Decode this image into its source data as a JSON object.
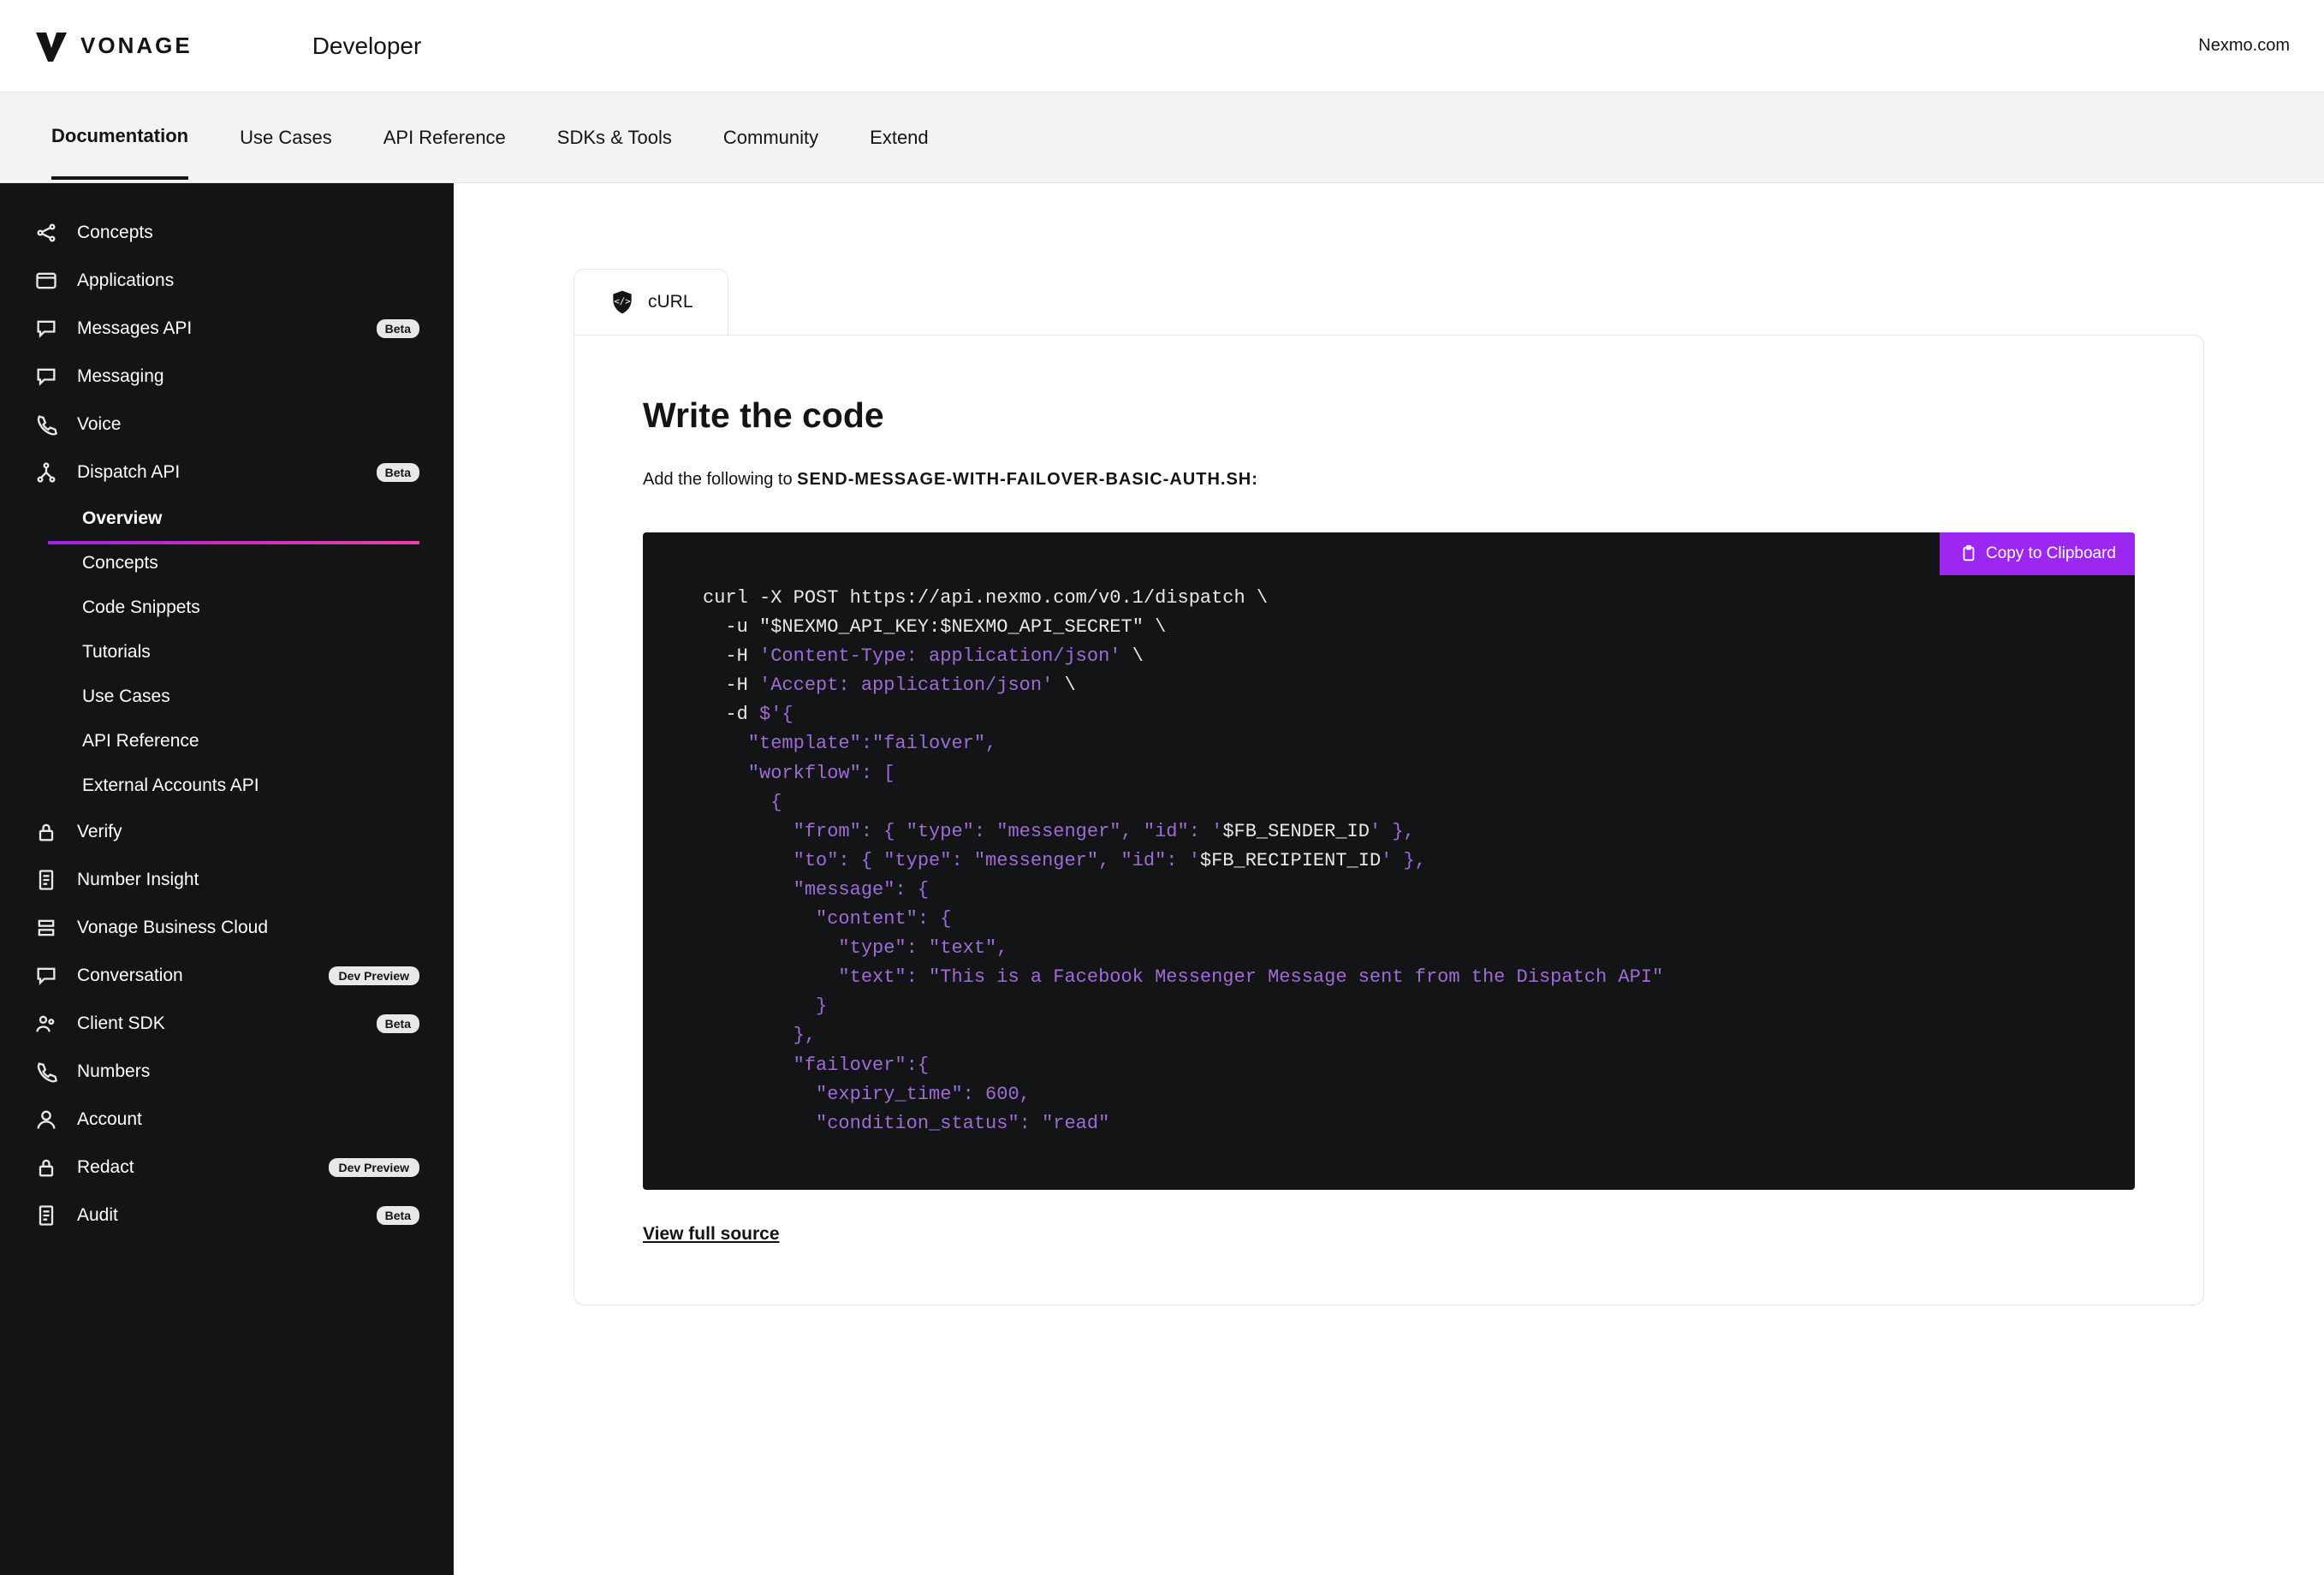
{
  "header": {
    "brand": "VONAGE",
    "developer": "Developer",
    "external_link": "Nexmo.com"
  },
  "topnav": [
    {
      "label": "Documentation",
      "active": true
    },
    {
      "label": "Use Cases"
    },
    {
      "label": "API Reference"
    },
    {
      "label": "SDKs & Tools"
    },
    {
      "label": "Community"
    },
    {
      "label": "Extend"
    }
  ],
  "sidebar": {
    "top": [
      {
        "icon": "share",
        "label": "Concepts"
      },
      {
        "icon": "window",
        "label": "Applications"
      },
      {
        "icon": "chat",
        "label": "Messages API",
        "badge": "Beta"
      },
      {
        "icon": "chat",
        "label": "Messaging"
      },
      {
        "icon": "phone",
        "label": "Voice"
      },
      {
        "icon": "tree",
        "label": "Dispatch API",
        "badge": "Beta"
      }
    ],
    "sub": [
      {
        "label": "Overview",
        "active": true
      },
      {
        "label": "Concepts"
      },
      {
        "label": "Code Snippets"
      },
      {
        "label": "Tutorials"
      },
      {
        "label": "Use Cases"
      },
      {
        "label": "API Reference"
      },
      {
        "label": "External Accounts API"
      }
    ],
    "bottom": [
      {
        "icon": "lock",
        "label": "Verify"
      },
      {
        "icon": "doc",
        "label": "Number Insight"
      },
      {
        "icon": "stack",
        "label": "Vonage Business Cloud"
      },
      {
        "icon": "chat",
        "label": "Conversation",
        "badge": "Dev Preview"
      },
      {
        "icon": "users",
        "label": "Client SDK",
        "badge": "Beta"
      },
      {
        "icon": "dial",
        "label": "Numbers"
      },
      {
        "icon": "user",
        "label": "Account"
      },
      {
        "icon": "lock",
        "label": "Redact",
        "badge": "Dev Preview"
      },
      {
        "icon": "doc",
        "label": "Audit",
        "badge": "Beta"
      }
    ]
  },
  "content": {
    "tab_label": "cURL",
    "heading": "Write the code",
    "instruction_prefix": "Add the following to ",
    "filename": "SEND-MESSAGE-WITH-FAILOVER-BASIC-AUTH.SH:",
    "copy_label": "Copy to Clipboard",
    "view_source": "View full source",
    "code": {
      "l1": "curl -X POST https://api.nexmo.com/v0.1/dispatch \\",
      "l2a": "  -u \"",
      "l2b": "$NEXMO_API_KEY",
      "l2c": ":",
      "l2d": "$NEXMO_API_SECRET",
      "l2e": "\" \\",
      "l3a": "  -H ",
      "l3b": "'Content-Type: application/json'",
      "l3c": " \\",
      "l4a": "  -H ",
      "l4b": "'Accept: application/json'",
      "l4c": " \\",
      "l5a": "  -d ",
      "l5b": "$'",
      "l5c": "{",
      "l6": "    \"template\":\"failover\",",
      "l7": "    \"workflow\": [",
      "l8": "      {",
      "l9a": "        \"from\": { \"type\": \"messenger\", \"id\": '",
      "l9b": "$FB_SENDER_ID",
      "l9c": "' },",
      "l10a": "        \"to\": { \"type\": \"messenger\", \"id\": '",
      "l10b": "$FB_RECIPIENT_ID",
      "l10c": "' },",
      "l11": "        \"message\": {",
      "l12": "          \"content\": {",
      "l13": "            \"type\": \"text\",",
      "l14": "            \"text\": \"This is a Facebook Messenger Message sent from the Dispatch API\"",
      "l15": "          }",
      "l16": "        },",
      "l17": "        \"failover\":{",
      "l18": "          \"expiry_time\": 600,",
      "l19": "          \"condition_status\": \"read\""
    }
  }
}
